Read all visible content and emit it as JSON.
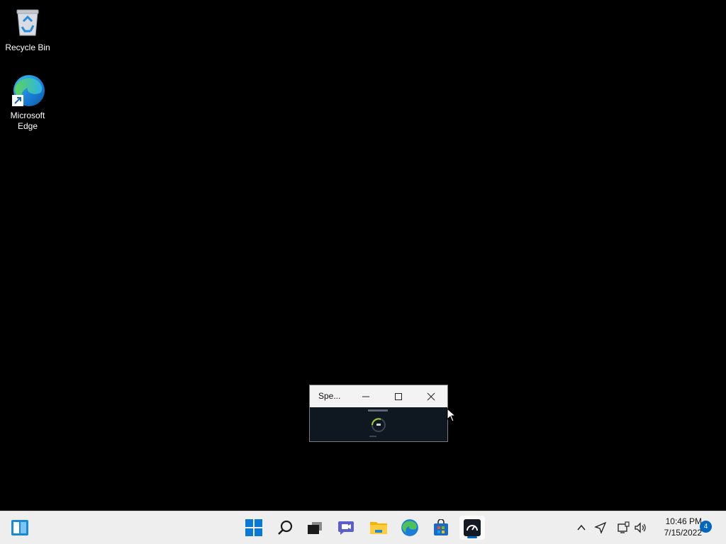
{
  "desktop": {
    "icons": [
      {
        "label": "Recycle Bin",
        "icon": "recycle-bin-icon"
      },
      {
        "label": "Microsoft Edge",
        "icon": "edge-icon"
      }
    ]
  },
  "thumbnail": {
    "title": "Spe...",
    "minimize_icon": "minimize-icon",
    "maximize_icon": "maximize-icon",
    "close_icon": "close-icon"
  },
  "taskbar": {
    "apps": [
      {
        "name": "widgets",
        "icon": "widgets-icon"
      },
      {
        "name": "start",
        "icon": "windows-start-icon"
      },
      {
        "name": "search",
        "icon": "search-icon"
      },
      {
        "name": "task-view",
        "icon": "task-view-icon"
      },
      {
        "name": "chat",
        "icon": "teams-chat-icon"
      },
      {
        "name": "file-explorer",
        "icon": "folder-icon"
      },
      {
        "name": "edge",
        "icon": "edge-icon"
      },
      {
        "name": "store",
        "icon": "store-icon"
      },
      {
        "name": "speedtest",
        "icon": "speedtest-icon",
        "active": true
      }
    ],
    "tray": {
      "icons": [
        "chevron-up-icon",
        "location-icon",
        "network-icon",
        "volume-icon"
      ],
      "time": "10:46 PM",
      "date": "7/15/2022",
      "notification_count": "4"
    }
  },
  "colors": {
    "desktop_bg": "#000000",
    "taskbar_bg": "#eeeeee",
    "accent": "#0067c0"
  }
}
